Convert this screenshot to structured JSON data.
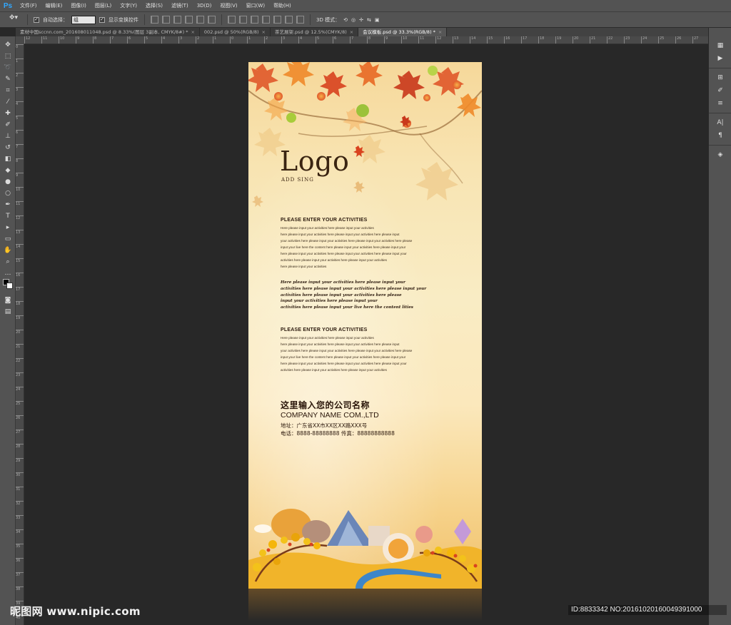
{
  "app": {
    "logo": "Ps"
  },
  "menu": [
    "文件(F)",
    "编辑(E)",
    "图像(I)",
    "图层(L)",
    "文字(Y)",
    "选择(S)",
    "滤镜(T)",
    "3D(D)",
    "视图(V)",
    "窗口(W)",
    "帮助(H)"
  ],
  "options": {
    "tool_icon": "move-icon",
    "auto_select_label": "自动选择：",
    "auto_select_value": "组",
    "show_transform_label": "显示变换控件",
    "mode_label": "3D 模式："
  },
  "tabs": [
    {
      "label": "素材中国sccnn.com_2016080110​48.psd @ 8.33%(图层 3副本, CMYK/8#) *",
      "active": false
    },
    {
      "label": "002.psd @ 50%(RGB/8)",
      "active": false
    },
    {
      "label": "茶艺展架.psd @ 12.5%(CMYK/8)",
      "active": false
    },
    {
      "label": "会议模板.psd @ 33.3%(RGB/8) *",
      "active": true
    }
  ],
  "ruler_top": [
    "12",
    "11",
    "10",
    "9",
    "8",
    "7",
    "6",
    "5",
    "4",
    "3",
    "2",
    "1",
    "0",
    "1",
    "2",
    "3",
    "4",
    "5",
    "6",
    "7",
    "8",
    "9",
    "10",
    "11",
    "12",
    "13",
    "14",
    "15",
    "16",
    "17",
    "18",
    "19",
    "20",
    "21",
    "22",
    "23",
    "24",
    "25",
    "26",
    "27"
  ],
  "ruler_left": [
    "0",
    "1",
    "2",
    "3",
    "4",
    "5",
    "6",
    "7",
    "8",
    "9",
    "10",
    "11",
    "12",
    "13",
    "14",
    "15",
    "16",
    "17",
    "18",
    "19",
    "20",
    "21",
    "22",
    "23",
    "24",
    "25",
    "26",
    "27",
    "28",
    "29",
    "30",
    "31",
    "32",
    "33",
    "34",
    "35",
    "36",
    "37",
    "38",
    "39",
    "40"
  ],
  "poster": {
    "logo": "Logo",
    "logo_sub": "ADD SING",
    "section1_title": "PLEASE ENTER YOUR ACTIVITIES",
    "section1_lines": [
      "Here please input your activities here please input your activities",
      "here please input your activities here please input your activities here please input",
      "your activities here please input your activities here please input your activities here please",
      "input your live here the content here please input your activities here please input your",
      "here please input your activities here please input your activities here please input your",
      " activities here please input your activities here please input your activities",
      "here please input your activities"
    ],
    "script_lines": [
      "Here please input your activities here please input your",
      "activities here please input your activities here please input your",
      "activities here please input your activities here please",
      "input your activities here please input your",
      "activities here please input your live here the content lities"
    ],
    "section2_title": "PLEASE ENTER YOUR ACTIVITIES",
    "section2_lines": [
      "Here please input your activities here please input your activities",
      "here please input your activities here please input your activities here please input",
      "your activities here please input your activities here please input your activities here please",
      "input your live here the content here please input your activities here please input your",
      "here please input your activities here please input your activities here please input your",
      " activities here please input your activities here please input your activities"
    ],
    "company_cn": "这里输入您的公司名称",
    "company_en": "COMPANY NAME COM.,LTD",
    "address": "地址：广东省XX市XX区XX路XXX号",
    "phone": "电话：8888-88888888  传真：88888888888"
  },
  "watermark": {
    "left": "昵图网 www.nipic.com",
    "right": "ID:8833342 NO:20161020160049391000"
  },
  "colors": {
    "ps_blue": "#31a8ff",
    "poster_text": "#2a160a",
    "leaf_red": "#d9431f",
    "leaf_orange": "#f2942b"
  }
}
